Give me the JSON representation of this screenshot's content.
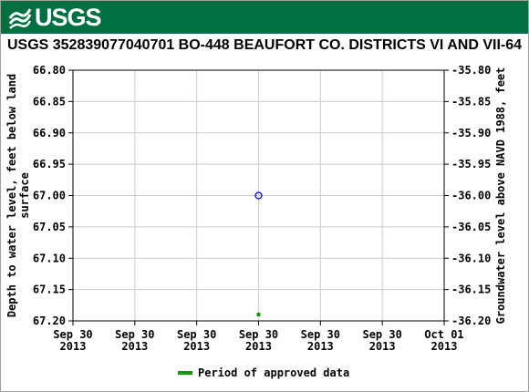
{
  "header": {
    "logo_text": "USGS"
  },
  "chart_data": {
    "type": "scatter",
    "title": "USGS 352839077040701 BO-448 BEAUFORT CO. DISTRICTS VI AND VII-64",
    "ylabel_left": "Depth to water level, feet below land surface",
    "ylabel_right": "Groundwater level above NAVD 1988, feet",
    "left_axis": {
      "min": 66.8,
      "max": 67.2,
      "ticks": [
        "66.80",
        "66.85",
        "66.90",
        "66.95",
        "67.00",
        "67.05",
        "67.10",
        "67.15",
        "67.20"
      ],
      "inverted": true
    },
    "right_axis": {
      "ticks": [
        "-35.80",
        "-35.85",
        "-35.90",
        "-35.95",
        "-36.00",
        "-36.05",
        "-36.10",
        "-36.15",
        "-36.20"
      ]
    },
    "x_ticks": [
      [
        "Sep 30",
        "2013"
      ],
      [
        "Sep 30",
        "2013"
      ],
      [
        "Sep 30",
        "2013"
      ],
      [
        "Sep 30",
        "2013"
      ],
      [
        "Sep 30",
        "2013"
      ],
      [
        "Sep 30",
        "2013"
      ],
      [
        "Oct 01",
        "2013"
      ]
    ],
    "grid": true,
    "points": [
      {
        "tick_index": 3,
        "depth": 67.0,
        "marker": "circle",
        "color": "#0000cc"
      }
    ],
    "approved_period": {
      "tick_index": 3,
      "color": "#119900"
    },
    "legend": [
      {
        "label": "Period of approved data",
        "color": "#119900"
      }
    ]
  }
}
